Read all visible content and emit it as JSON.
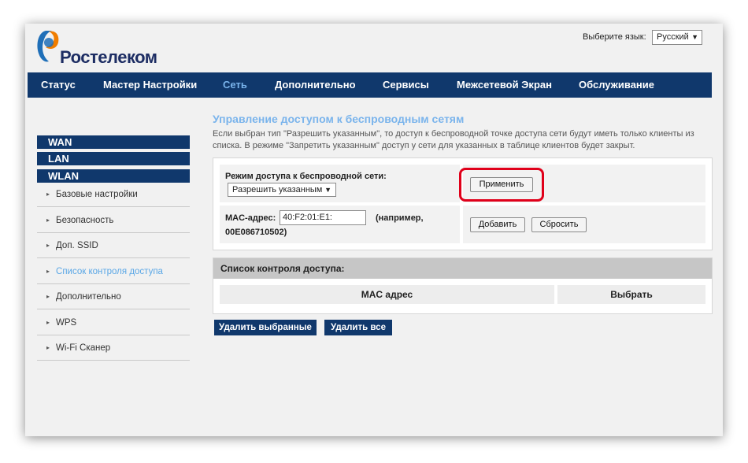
{
  "header": {
    "brand": "Ростелеком",
    "language_label": "Выберите язык:",
    "language_value": "Русский"
  },
  "nav": {
    "items": [
      {
        "label": "Статус"
      },
      {
        "label": "Мастер Настройки"
      },
      {
        "label": "Сеть",
        "active": true
      },
      {
        "label": "Дополнительно"
      },
      {
        "label": "Сервисы"
      },
      {
        "label": "Межсетевой Экран"
      },
      {
        "label": "Обслуживание"
      }
    ]
  },
  "sidebar": {
    "headers": [
      "WAN",
      "LAN",
      "WLAN"
    ],
    "items": [
      {
        "label": "Базовые настройки"
      },
      {
        "label": "Безопасность"
      },
      {
        "label": "Доп. SSID"
      },
      {
        "label": "Список контроля доступа",
        "active": true
      },
      {
        "label": "Дополнительно"
      },
      {
        "label": "WPS"
      },
      {
        "label": "Wi-Fi Сканер"
      }
    ]
  },
  "content": {
    "title": "Управление доступом к беспроводным сетям",
    "description": "Если выбран тип \"Разрешить указанным\", то доступ к беспроводной точке доступа сети будут иметь только клиенты из списка. В режиме \"Запретить указанным\" доступ у сети для указанных в таблице клиентов будет закрыт.",
    "mode_label": "Режим доступа к беспроводной сети:",
    "mode_value": "Разрешить указанным",
    "apply_label": "Применить",
    "mac_label": "MAC-адрес:",
    "mac_value": "40:F2:01:E1:",
    "mac_example": "(например, 00E086710502)",
    "add_label": "Добавить",
    "reset_label": "Сбросить",
    "list_title": "Список контроля доступа:",
    "columns": [
      "MAC адрес",
      "Выбрать"
    ],
    "delete_selected_label": "Удалить выбранные",
    "delete_all_label": "Удалить все"
  },
  "colors": {
    "nav_bg": "#10386c",
    "accent": "#7ab4ec",
    "highlight": "#e0001a"
  }
}
